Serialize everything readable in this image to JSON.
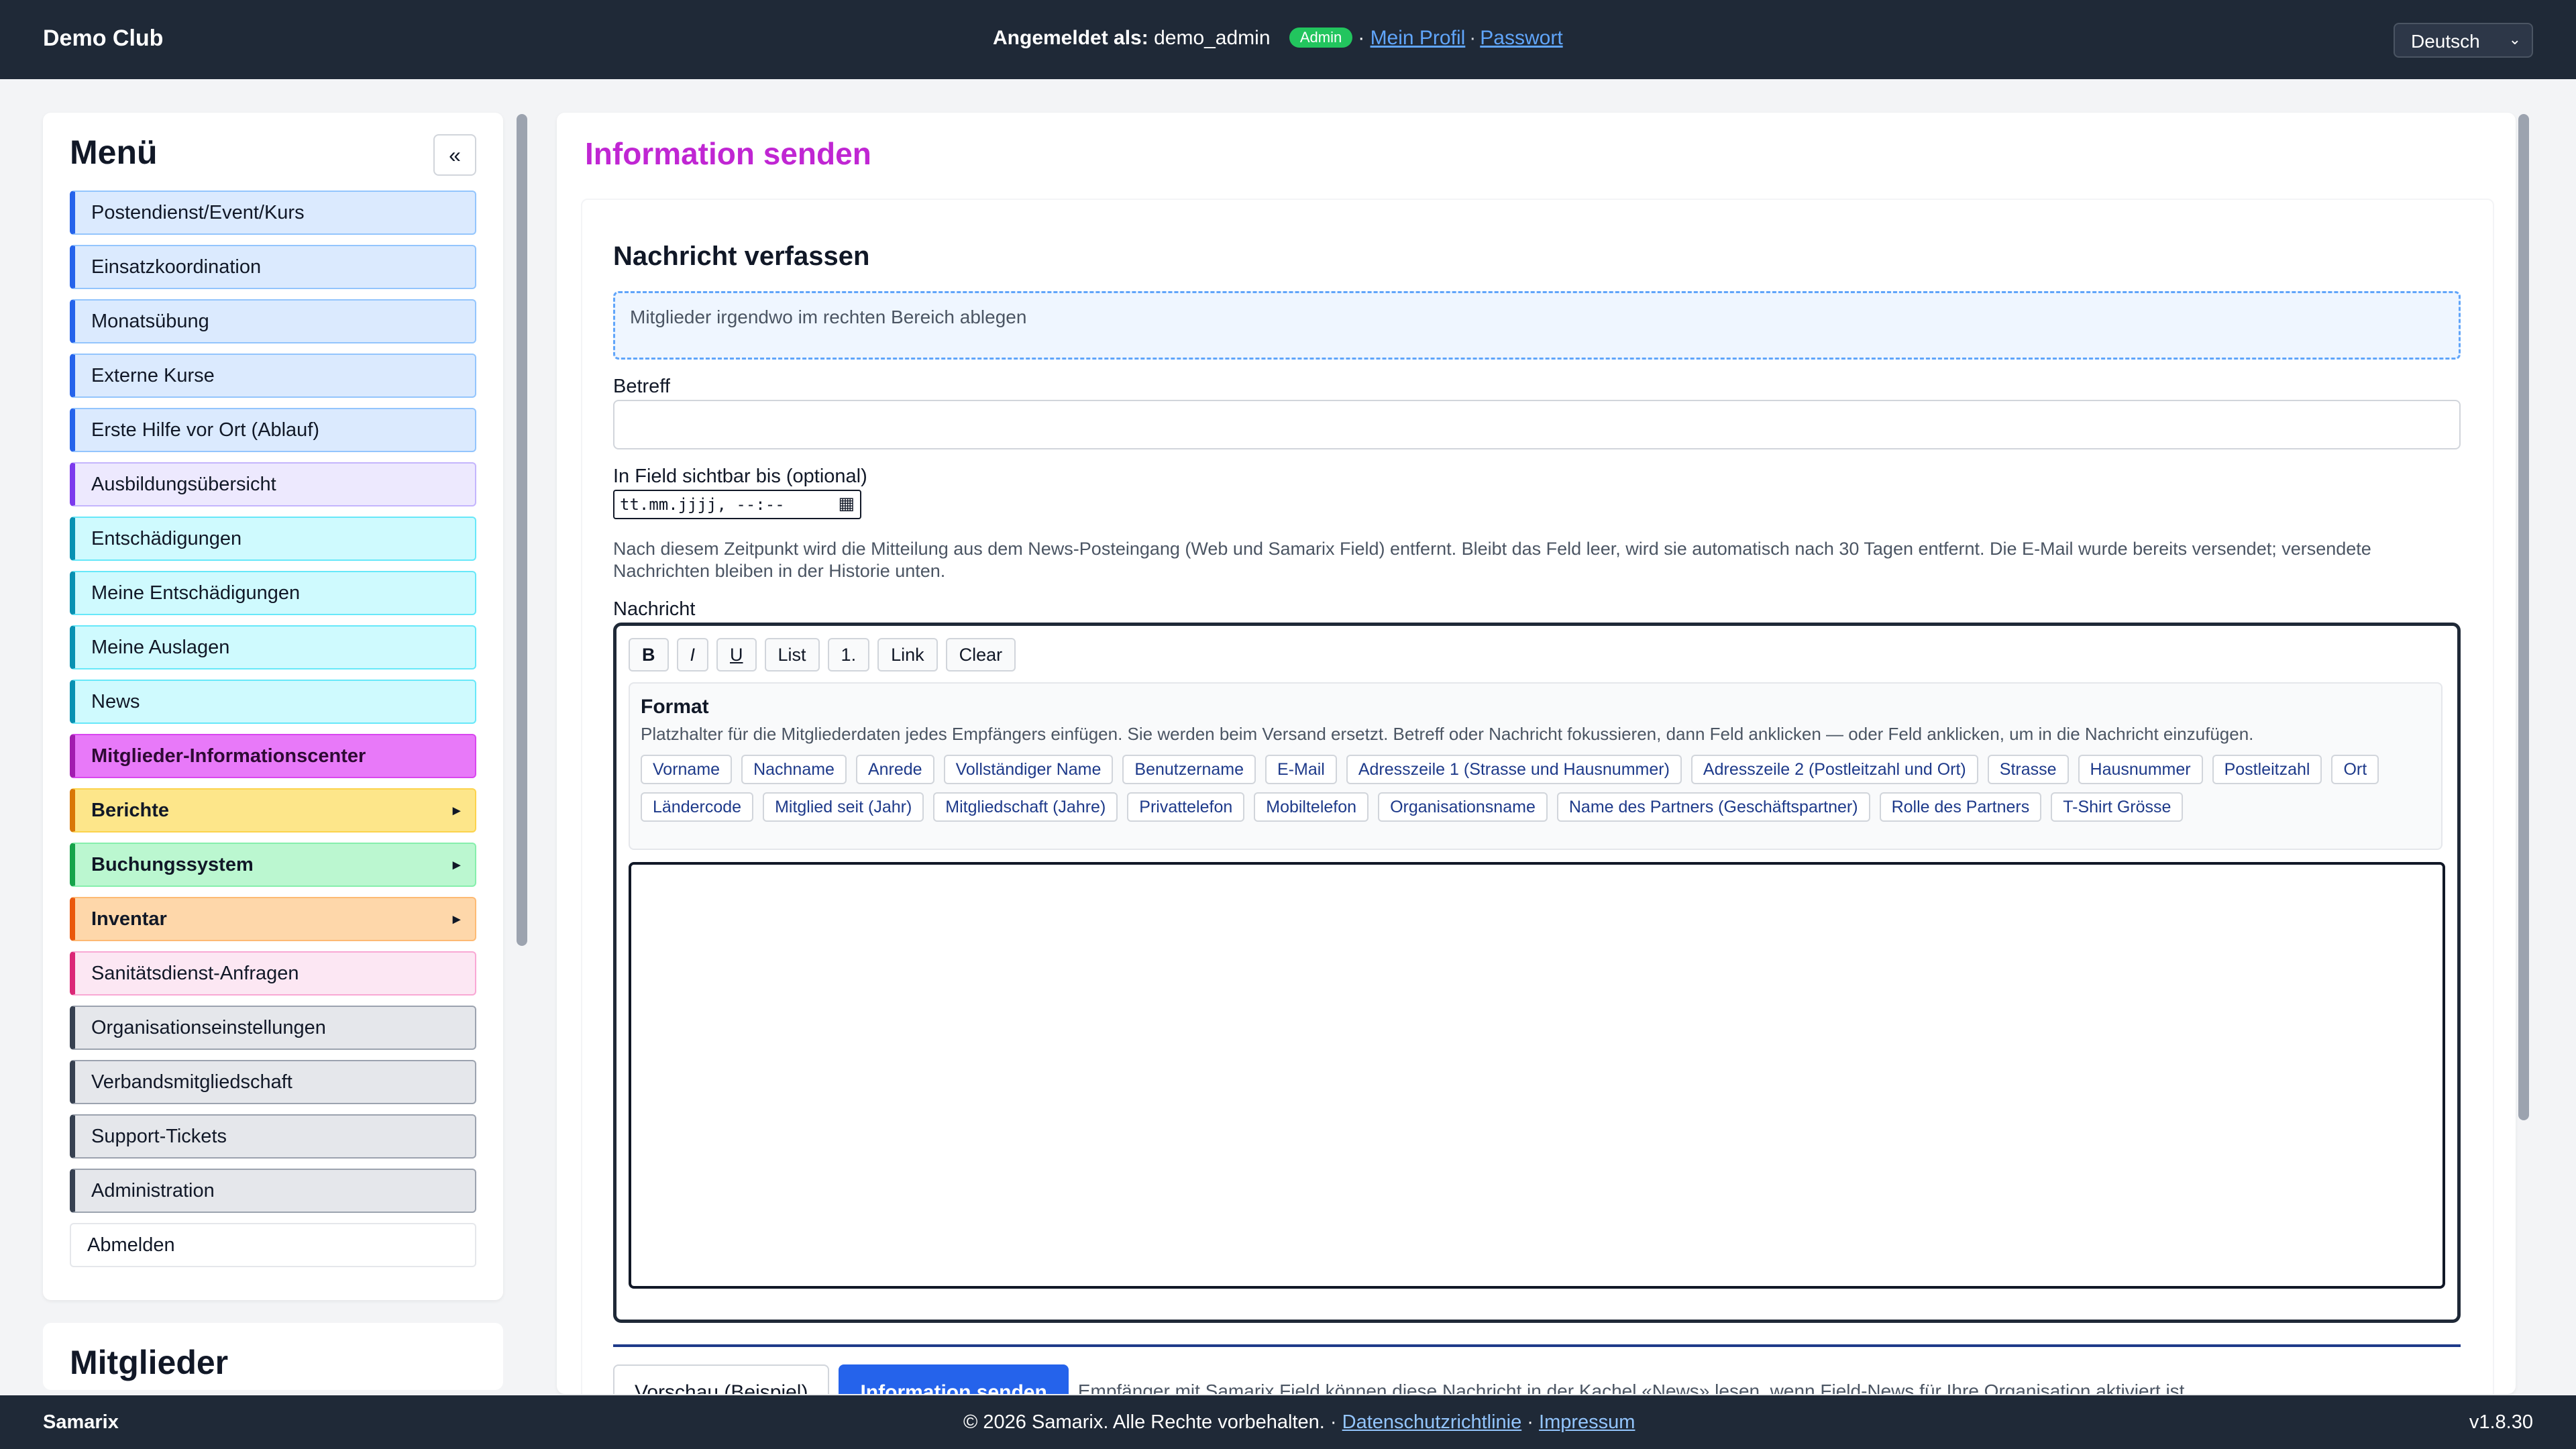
{
  "header": {
    "brand": "Demo Club",
    "logged_in_label": "Angemeldet als:",
    "username": "demo_admin",
    "role_badge": "Admin",
    "separator": "·",
    "profile_link": "Mein Profil",
    "password_link": "Passwort",
    "language": "Deutsch"
  },
  "sidebar": {
    "title": "Menü",
    "collapse": "«",
    "items": [
      {
        "label": "Postendienst/Event/Kurs"
      },
      {
        "label": "Einsatzkoordination"
      },
      {
        "label": "Monatsübung"
      },
      {
        "label": "Externe Kurse"
      },
      {
        "label": "Erste Hilfe vor Ort (Ablauf)"
      },
      {
        "label": "Ausbildungsübersicht"
      },
      {
        "label": "Entschädigungen"
      },
      {
        "label": "Meine Entschädigungen"
      },
      {
        "label": "Meine Auslagen"
      },
      {
        "label": "News"
      },
      {
        "label": "Mitglieder-Informationscenter"
      },
      {
        "label": "Berichte",
        "arrow": "▸"
      },
      {
        "label": "Buchungssystem",
        "arrow": "▸"
      },
      {
        "label": "Inventar",
        "arrow": "▸"
      },
      {
        "label": "Sanitätsdienst-Anfragen"
      },
      {
        "label": "Organisationseinstellungen"
      },
      {
        "label": "Verbandsmitgliedschaft"
      },
      {
        "label": "Support-Tickets"
      },
      {
        "label": "Administration"
      },
      {
        "label": "Abmelden"
      }
    ],
    "second_panel_title": "Mitglieder"
  },
  "main": {
    "title": "Information senden",
    "compose_title": "Nachricht verfassen",
    "dropzone_text": "Mitglieder irgendwo im rechten Bereich ablegen",
    "subject_label": "Betreff",
    "subject_value": "",
    "visible_until_label": "In Field sichtbar bis (optional)",
    "date_placeholder": "tt.mm.jjjj, --:--",
    "hint": "Nach diesem Zeitpunkt wird die Mitteilung aus dem News-Posteingang (Web und Samarix Field) entfernt. Bleibt das Feld leer, wird sie automatisch nach 30 Tagen entfernt. Die E-Mail wurde bereits versendet; versendete Nachrichten bleiben in der Historie unten.",
    "message_label": "Nachricht",
    "toolbar": [
      "B",
      "I",
      "U",
      "List",
      "1.",
      "Link",
      "Clear"
    ],
    "format_title": "Format",
    "format_desc": "Platzhalter für die Mitgliederdaten jedes Empfängers einfügen. Sie werden beim Versand ersetzt. Betreff oder Nachricht fokussieren, dann Feld anklicken — oder Feld anklicken, um in die Nachricht einzufügen.",
    "placeholders": [
      "Vorname",
      "Nachname",
      "Anrede",
      "Vollständiger Name",
      "Benutzername",
      "E-Mail",
      "Adresszeile 1 (Strasse und Hausnummer)",
      "Adresszeile 2 (Postleitzahl und Ort)",
      "Strasse",
      "Hausnummer",
      "Postleitzahl",
      "Ort",
      "Ländercode",
      "Mitglied seit (Jahr)",
      "Mitgliedschaft (Jahre)",
      "Privattelefon",
      "Mobiltelefon",
      "Organisationsname",
      "Name des Partners (Geschäftspartner)",
      "Rolle des Partners",
      "T-Shirt Grösse"
    ],
    "preview_button": "Vorschau (Beispiel)",
    "send_button": "Information senden",
    "action_note": "Empfänger mit Samarix Field können diese Nachricht in der Kachel «News» lesen, wenn Field-News für Ihre Organisation aktiviert ist."
  },
  "footer": {
    "brand": "Samarix",
    "copyright": "© 2026 Samarix. Alle Rechte vorbehalten.",
    "separator": "·",
    "privacy_link": "Datenschutzrichtlinie",
    "imprint_link": "Impressum",
    "version": "v1.8.30"
  },
  "colors": {
    "topbar": "#1f2937",
    "title_accent": "#c026d3",
    "primary_button": "#2563eb",
    "admin_badge": "#22c55e",
    "link": "#60a5fa"
  }
}
